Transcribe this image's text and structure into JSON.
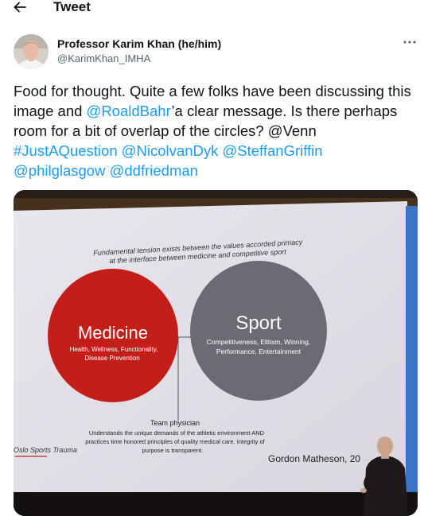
{
  "header": {
    "back_icon": "arrow-left-icon",
    "title": "Tweet"
  },
  "author": {
    "name": "Professor Karim Khan (he/him)",
    "handle": "@KarimKhan_IMHA",
    "more_icon": "more-horizontal-icon"
  },
  "tweet": {
    "segments": [
      {
        "text": "Food for thought. Quite a few folks have been discussing this image and ",
        "link": false
      },
      {
        "text": "@RoaldBahr",
        "link": true
      },
      {
        "text": "’a clear message. Is there perhaps room for a bit of overlap of the circles? @Venn ",
        "link": false
      },
      {
        "text": "#JustAQuestion",
        "link": true
      },
      {
        "text": " ",
        "link": false
      },
      {
        "text": "@NicolvanDyk",
        "link": true
      },
      {
        "text": " ",
        "link": false
      },
      {
        "text": "@SteffanGriffin",
        "link": true
      },
      {
        "text": " ",
        "link": false
      },
      {
        "text": "@philglasgow",
        "link": true
      },
      {
        "text": " ",
        "link": false
      },
      {
        "text": "@ddfriedman",
        "link": true
      }
    ]
  },
  "slide": {
    "caption_line1": "Fundamental tension exists between the values accorded primacy",
    "caption_line2": "at the interface between medicine and competitive sport",
    "medicine_title": "Medicine",
    "medicine_line1": "Health, Wellness, Functionality,",
    "medicine_line2": "Disease Prevention",
    "sport_title": "Sport",
    "sport_line1": "Competitiveness, Elitism, Winning,",
    "sport_line2": "Performance, Entertainment",
    "team_title": "Team physician",
    "team_line1": "Understands the unique demands of the athletic environment AND",
    "team_line2": "practices time honored principles of quality medical care. Integrity of",
    "team_line3": "purpose is transparent.",
    "author_credit": "Gordon Matheson, 20",
    "logo_text": "Oslo Sports Trauma",
    "colors": {
      "medicine": "#c41e1a",
      "sport": "#6d6a73"
    }
  }
}
